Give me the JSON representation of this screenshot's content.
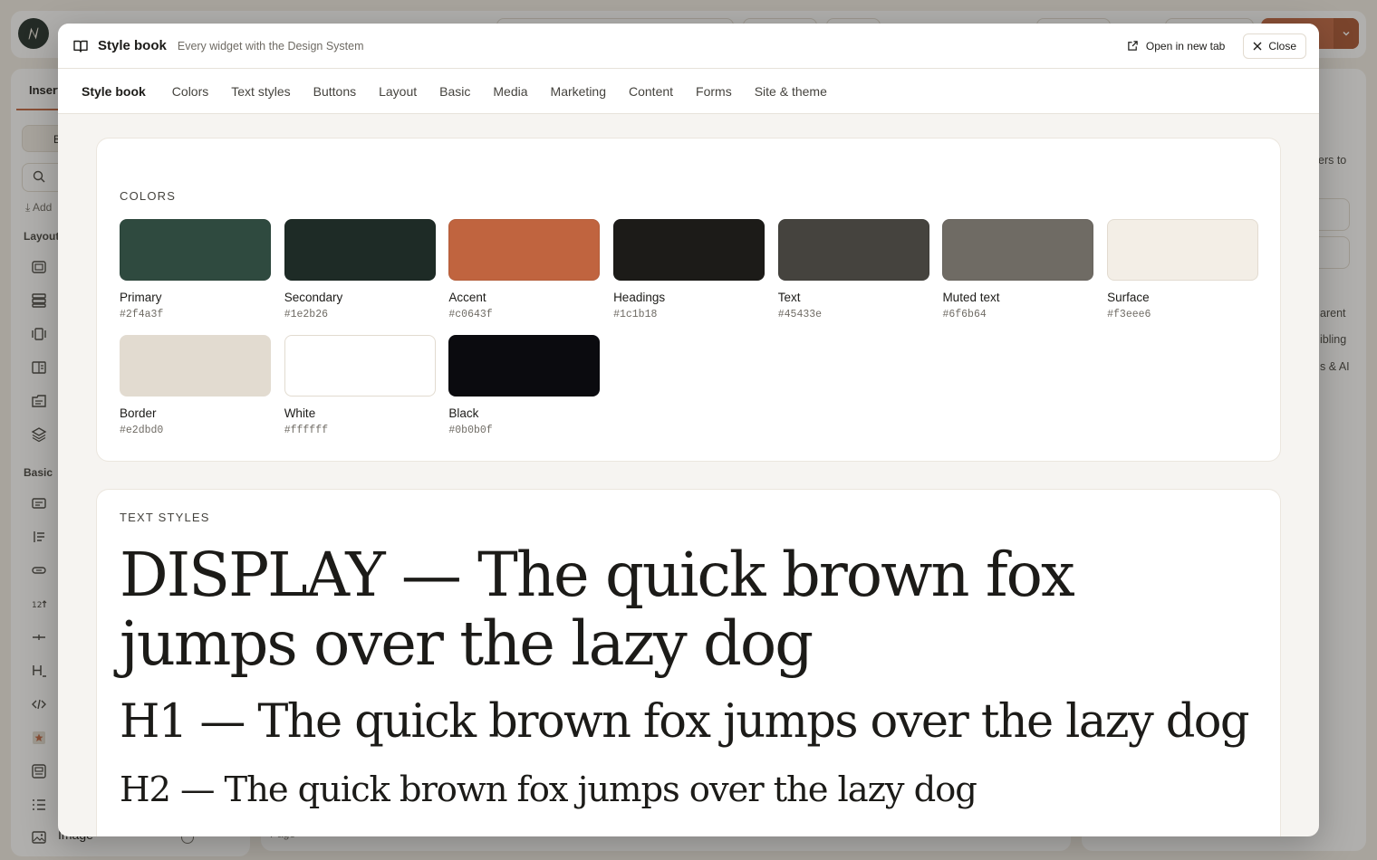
{
  "background": {
    "left_panel": {
      "tab": "Insert",
      "button": "B",
      "add_label": "Add",
      "sections": [
        "Layout",
        "Basic"
      ],
      "image_item": "Image"
    },
    "canvas": {
      "label": "Page"
    },
    "right_panel": {
      "texts": [
        "ers to",
        "arent",
        "ibling",
        "s & AI"
      ]
    }
  },
  "modal": {
    "title": "Style book",
    "subtitle": "Every widget with the Design System",
    "open_link": "Open in new tab",
    "close_label": "Close"
  },
  "tabs": [
    {
      "label": "Style book",
      "active": true
    },
    {
      "label": "Colors"
    },
    {
      "label": "Text styles"
    },
    {
      "label": "Buttons"
    },
    {
      "label": "Layout"
    },
    {
      "label": "Basic"
    },
    {
      "label": "Media"
    },
    {
      "label": "Marketing"
    },
    {
      "label": "Content"
    },
    {
      "label": "Forms"
    },
    {
      "label": "Site & theme"
    }
  ],
  "colors_section": {
    "label": "COLORS",
    "swatches": [
      {
        "name": "Primary",
        "hex": "#2f4a3f"
      },
      {
        "name": "Secondary",
        "hex": "#1e2b26"
      },
      {
        "name": "Accent",
        "hex": "#c0643f"
      },
      {
        "name": "Headings",
        "hex": "#1c1b18"
      },
      {
        "name": "Text",
        "hex": "#45433e"
      },
      {
        "name": "Muted text",
        "hex": "#6f6b64"
      },
      {
        "name": "Surface",
        "hex": "#f3eee6"
      },
      {
        "name": "Border",
        "hex": "#e2dbd0"
      },
      {
        "name": "White",
        "hex": "#ffffff"
      },
      {
        "name": "Black",
        "hex": "#0b0b0f"
      }
    ]
  },
  "text_styles_section": {
    "label": "TEXT STYLES",
    "display": "DISPLAY — The quick brown fox jumps over the lazy dog",
    "h1": "H1 — The quick brown fox jumps over the lazy dog",
    "h2": "H2 — The quick brown fox jumps over the lazy dog"
  }
}
